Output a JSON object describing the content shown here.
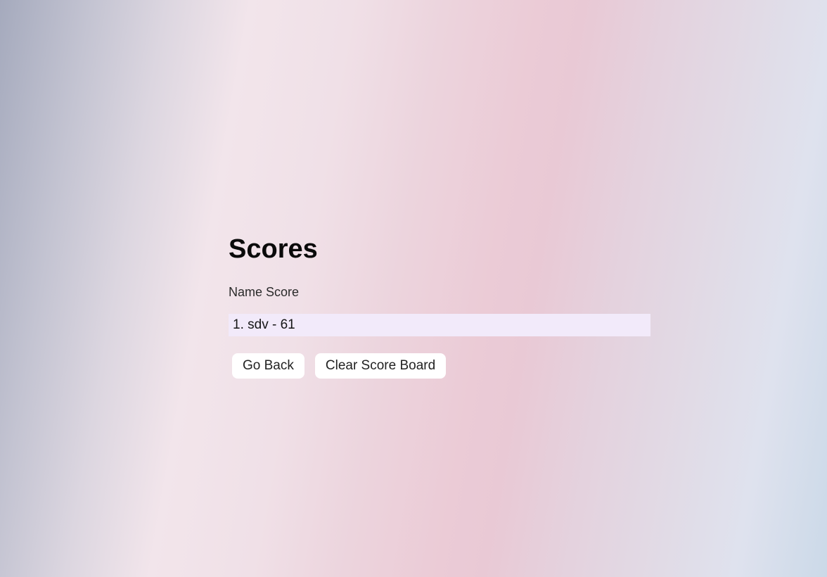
{
  "page": {
    "title": "Scores",
    "column_header": "Name Score"
  },
  "scores": [
    {
      "text": "1. sdv - 61"
    }
  ],
  "actions": {
    "go_back_label": "Go Back",
    "clear_label": "Clear Score Board"
  },
  "colors": {
    "list_item_bg": "#f2eafa",
    "button_bg": "#ffffff"
  }
}
